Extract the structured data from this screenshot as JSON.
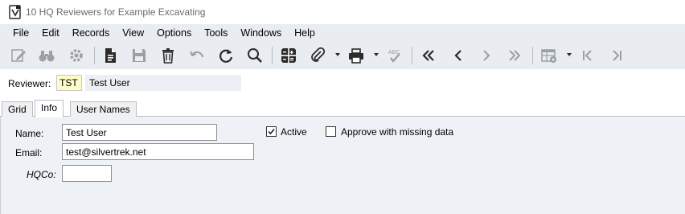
{
  "window": {
    "title": "10 HQ Reviewers for Example Excavating",
    "icon": "app-form-icon"
  },
  "menu": [
    "File",
    "Edit",
    "Records",
    "View",
    "Options",
    "Tools",
    "Windows",
    "Help"
  ],
  "toolbar": {
    "icons": [
      "edit-icon",
      "binoculars-icon",
      "gear-icon",
      "document-icon",
      "save-icon",
      "delete-icon",
      "undo-icon",
      "refresh-icon",
      "search-icon",
      "calculator-icon",
      "attach-icon",
      "print-icon",
      "spellcheck-icon",
      "first-record-icon",
      "previous-record-icon",
      "next-record-icon",
      "last-record-icon",
      "grid-settings-icon",
      "first-page-icon",
      "last-page-icon"
    ]
  },
  "reviewer": {
    "label": "Reviewer:",
    "code": "TST",
    "name": "Test User"
  },
  "tabs": [
    {
      "label": "Grid",
      "active": false
    },
    {
      "label": "Info",
      "active": true
    },
    {
      "label": "User Names",
      "active": false
    }
  ],
  "form": {
    "name_label": "Name:",
    "name_value": "Test User",
    "email_label": "Email:",
    "email_value": "test@silvertrek.net",
    "hqco_label": "HQCo:",
    "hqco_value": "",
    "active_label": "Active",
    "active_checked": true,
    "approve_label": "Approve with missing data",
    "approve_checked": false
  },
  "colors": {
    "chrome": "#e9ecf0",
    "panel": "#eef1f5",
    "code_highlight": "#fdfbc7",
    "title_text": "#6b6b6b"
  }
}
